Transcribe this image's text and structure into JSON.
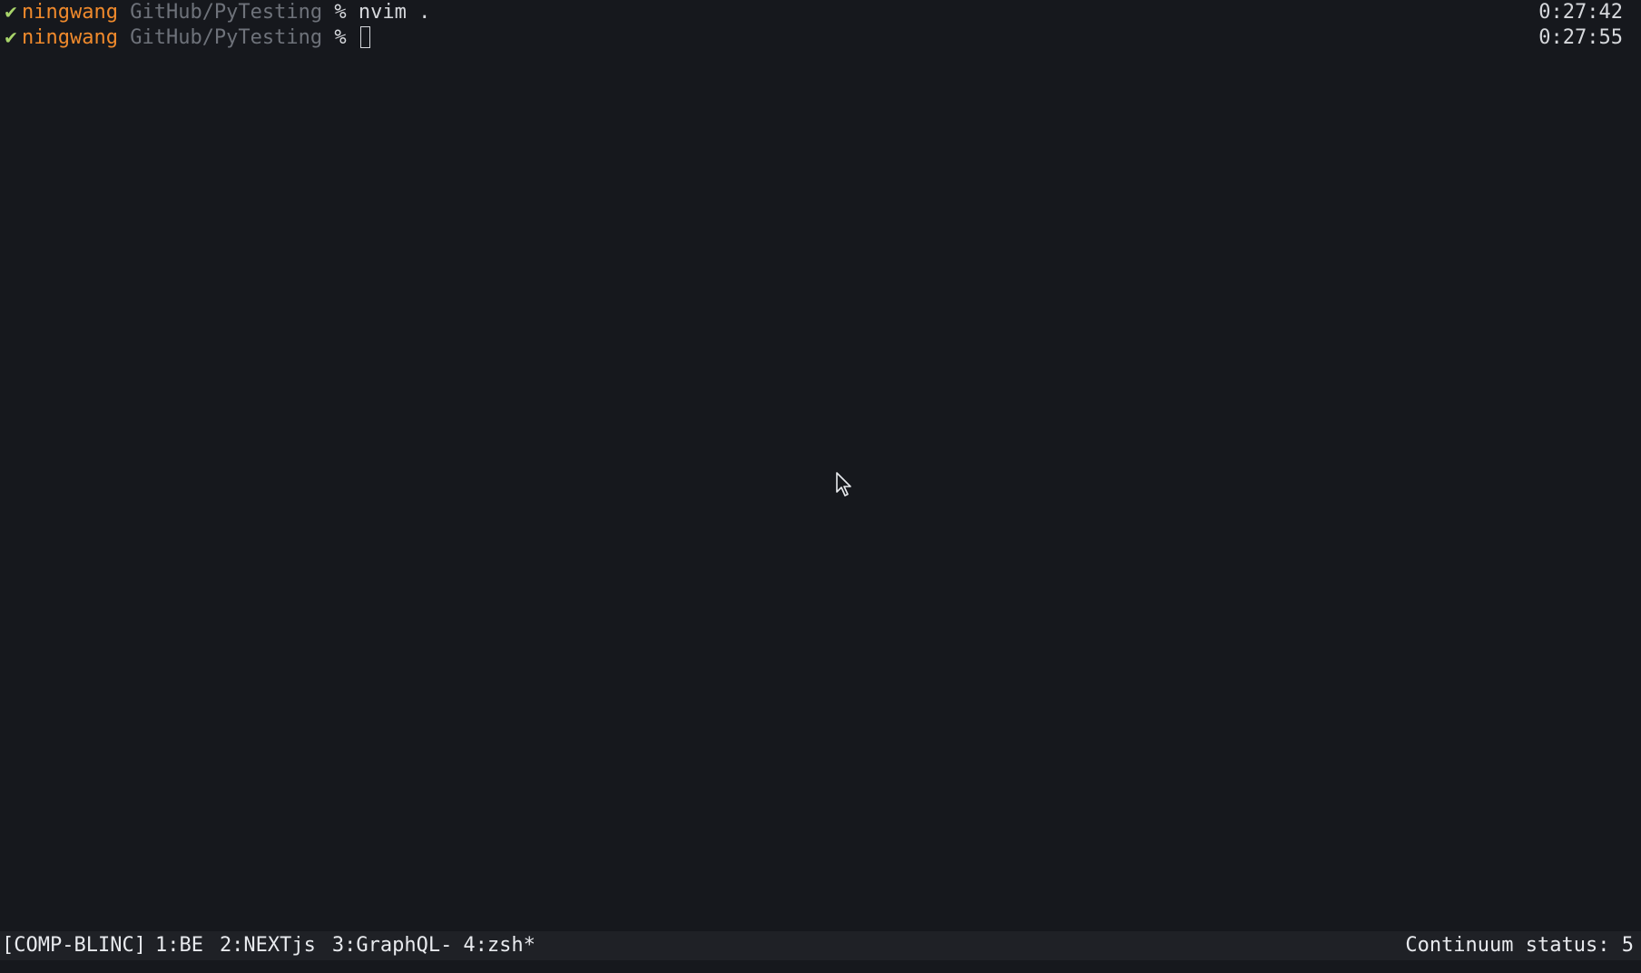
{
  "terminal": {
    "lines": [
      {
        "status_glyph": "✔",
        "user": "ningwang",
        "path": "GitHub/PyTesting",
        "prompt": "%",
        "command": "nvim .",
        "time": "0:27:42"
      },
      {
        "status_glyph": "✔",
        "user": "ningwang",
        "path": "GitHub/PyTesting",
        "prompt": "%",
        "command": "",
        "time": "0:27:55"
      }
    ]
  },
  "statusbar": {
    "session": "[COMP-BLINC]",
    "windows": [
      {
        "label": "1:BE"
      },
      {
        "label": "2:NEXTjs"
      },
      {
        "label": "3:GraphQL-"
      },
      {
        "label": "4:zsh*"
      }
    ],
    "right_text": "Continuum status: 5"
  },
  "colors": {
    "background": "#16181d",
    "user": "#f08a2c",
    "path": "#6e727a",
    "check": "#a8d46a",
    "statusbar_bg": "#1f2126"
  },
  "icons": {
    "mouse": "mouse-pointer-icon",
    "cursor": "text-cursor-block"
  }
}
